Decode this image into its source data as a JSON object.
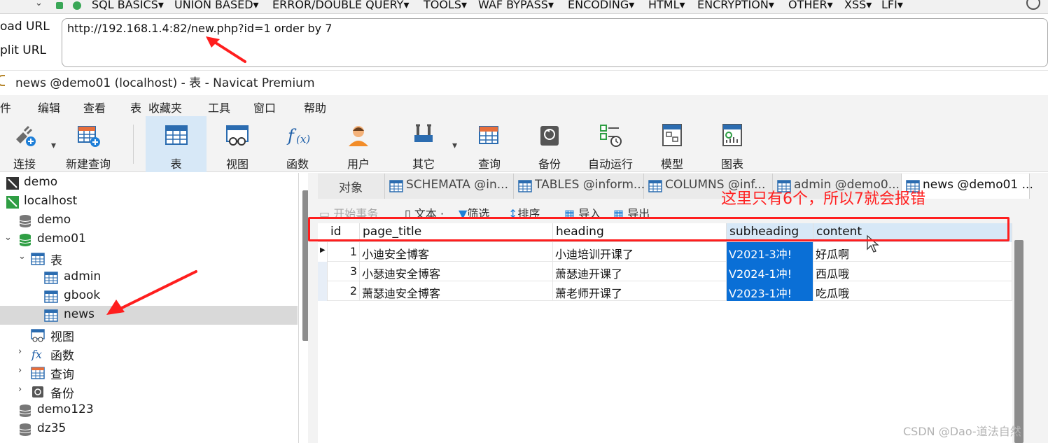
{
  "hackbar": {
    "menu": [
      "SQL BASICS▾",
      "UNION BASED▾",
      "ERROR/DOUBLE QUERY▾",
      "TOOLS▾",
      "WAF BYPASS▾",
      "ENCODING▾",
      "HTML▾",
      "ENCRYPTION▾",
      "OTHER▾",
      "XSS▾",
      "LFI▾"
    ],
    "load_url": "oad URL",
    "split_url": "plit URL",
    "url": "http://192.168.1.4:82/new.php?id=1 order by 7"
  },
  "window": {
    "title": "news @demo01 (localhost) - 表 - Navicat Premium"
  },
  "menubar": [
    "文件",
    "编辑",
    "查看",
    "表",
    "收藏夹",
    "工具",
    "窗口",
    "帮助"
  ],
  "menubar_first_visible": "件",
  "toolbar": {
    "connect": "连接",
    "new_query": "新建查询",
    "table": "表",
    "view": "视图",
    "function": "函数",
    "user": "用户",
    "other": "其它",
    "query": "查询",
    "backup": "备份",
    "autorun": "自动运行",
    "model": "模型",
    "chart": "图表"
  },
  "tree": {
    "items": [
      "demo",
      "localhost",
      "demo",
      "demo01",
      "表",
      "admin",
      "gbook",
      "news",
      "视图",
      "函数",
      "查询",
      "备份",
      "demo123",
      "dz35"
    ]
  },
  "tabs": [
    "对象",
    "SCHEMATA @in...",
    "TABLES @inform...",
    "COLUMNS @inf...",
    "admin @demo0...",
    "news @demo01 ..."
  ],
  "subtoolbar": {
    "begin_tx": "开始事务",
    "text": "文本 ·",
    "filter": "筛选",
    "sort": "排序",
    "import": "导入",
    "export": "导出"
  },
  "grid": {
    "columns": [
      "id",
      "page_title",
      "heading",
      "subheading",
      "content"
    ],
    "rows": [
      [
        "1",
        "小迪安全博客",
        "小迪培训开课了",
        "V2021-3冲!",
        "好瓜啊"
      ],
      [
        "3",
        "小瑟迪安全博客",
        "萧瑟迪开课了",
        "V2024-1冲!",
        "西瓜哦"
      ],
      [
        "2",
        "萧瑟迪安全博客",
        "萧老师开课了",
        "V2023-1冲!",
        "吃瓜哦"
      ]
    ]
  },
  "annotation": {
    "text": "这里只有6个，所以7就会报错",
    "color": "#ff2020"
  },
  "watermark": "CSDN @Dao-道法自然",
  "colors": {
    "selection": "#0a6fd6",
    "active_toolbar": "#d7e8f7",
    "annotation_red": "#ff1e1e"
  }
}
